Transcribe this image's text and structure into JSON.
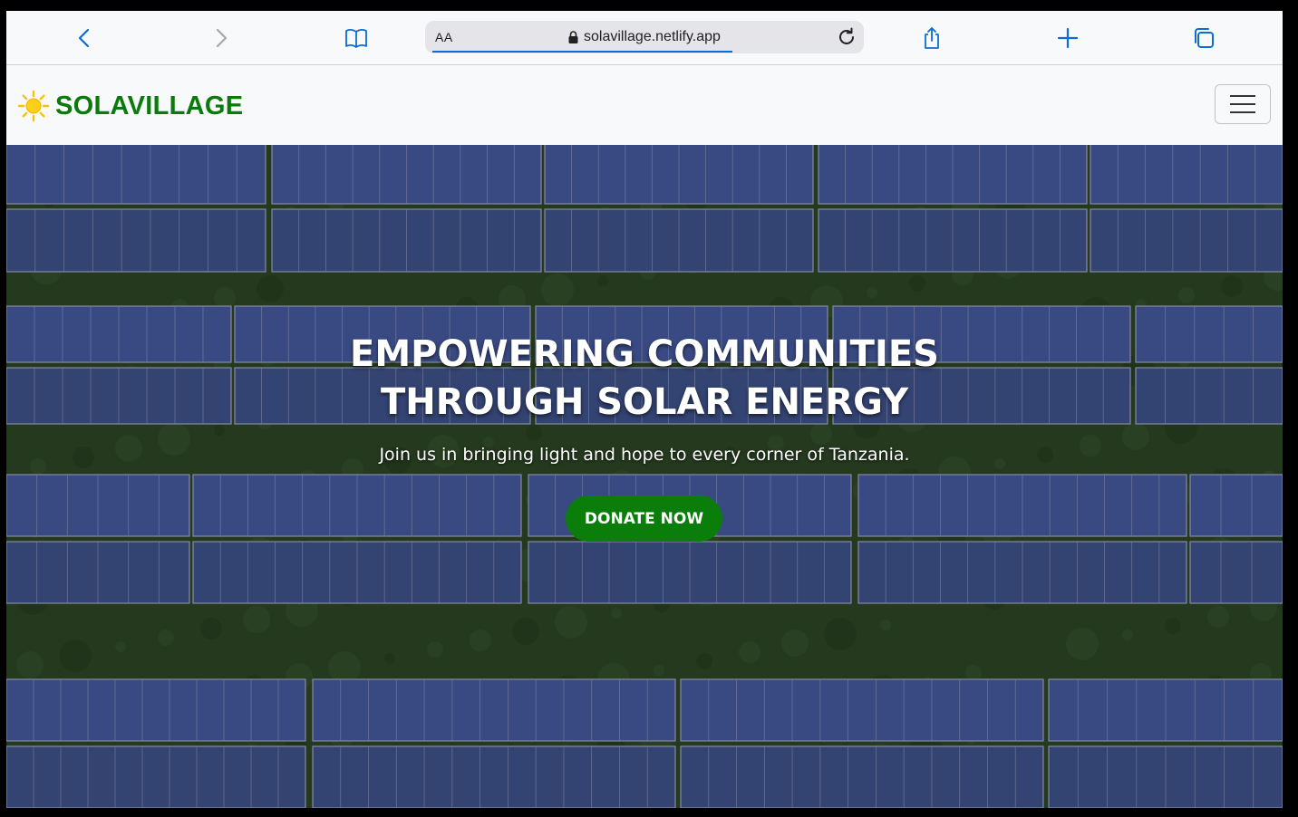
{
  "browser": {
    "aa_label": "AA",
    "url": "solavillage.netlify.app",
    "icons": {
      "back": "chevron-left-icon",
      "forward": "chevron-right-icon",
      "bookmarks": "book-icon",
      "reload": "reload-icon",
      "share": "share-icon",
      "new_tab": "plus-icon",
      "tabs": "tabs-icon",
      "secure": "lock-icon"
    }
  },
  "site": {
    "brand": "SOLAVILLAGE",
    "brand_color": "#0a7a0a",
    "logo_icon": "sun-icon",
    "menu_icon": "hamburger-icon"
  },
  "hero": {
    "title_line1": "EMPOWERING COMMUNITIES",
    "title_line2": "THROUGH SOLAR ENERGY",
    "subtitle": "Join us in bringing light and hope to every corner of Tanzania.",
    "cta_label": "DONATE NOW",
    "cta_color": "#0a7d0a"
  }
}
